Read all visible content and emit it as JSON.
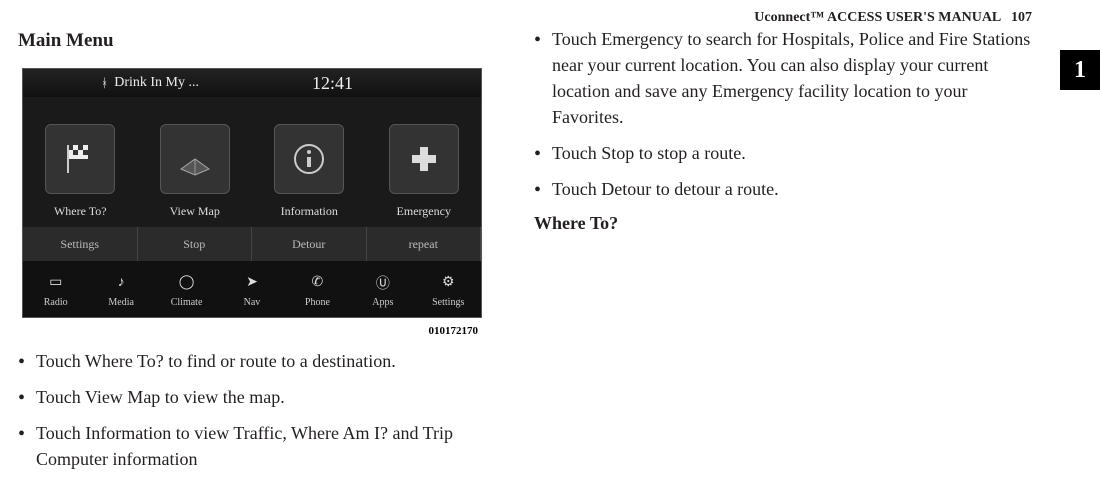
{
  "header": {
    "brand": "Uconnect™ ACCESS USER'S MANUAL",
    "page": "107",
    "tab": "1"
  },
  "left": {
    "main_menu_title": "Main Menu",
    "screenshot": {
      "status": {
        "drink": "Drink In My ...",
        "time": "12:41"
      },
      "main_tiles": [
        {
          "label": "Where To?"
        },
        {
          "label": "View Map"
        },
        {
          "label": "Information"
        },
        {
          "label": "Emergency"
        }
      ],
      "sec_tiles": [
        {
          "label": "Settings"
        },
        {
          "label": "Stop"
        },
        {
          "label": "Detour"
        },
        {
          "label": "repeat"
        }
      ],
      "bottom_tiles": [
        {
          "label": "Radio"
        },
        {
          "label": "Media"
        },
        {
          "label": "Climate"
        },
        {
          "label": "Nav"
        },
        {
          "label": "Phone"
        },
        {
          "label": "Apps"
        },
        {
          "label": "Settings"
        }
      ],
      "image_id": "010172170"
    },
    "bullets": [
      "Touch Where To? to find or route to a destination.",
      "Touch View Map to view the map.",
      "Touch Information to view Traffic, Where Am I? and Trip Computer information"
    ]
  },
  "right": {
    "bullets": [
      "Touch Emergency to search for Hospitals, Police and Fire Stations near your current location. You can also display your current location and save any Emergency facility location to your Favorites.",
      "Touch Stop to stop a route.",
      "Touch Detour to detour a route."
    ],
    "where_to": "Where To?"
  }
}
